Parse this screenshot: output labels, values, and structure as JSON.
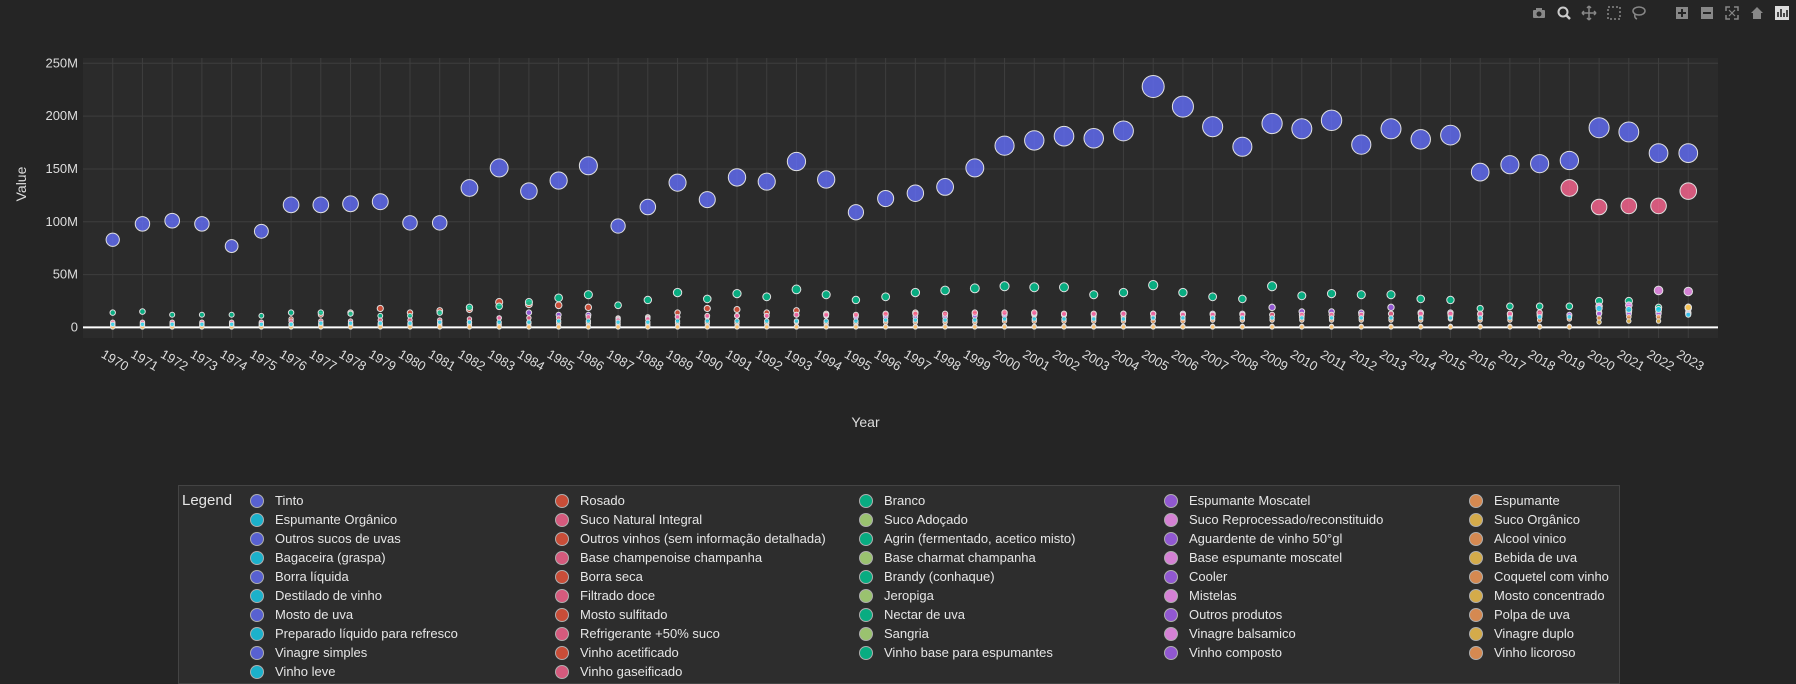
{
  "toolbar": {
    "buttons": [
      {
        "name": "camera-icon"
      },
      {
        "name": "zoom-icon"
      },
      {
        "name": "pan-icon"
      },
      {
        "name": "box-select-icon"
      },
      {
        "name": "lasso-icon"
      },
      {
        "name": "zoom-in-icon"
      },
      {
        "name": "zoom-out-icon"
      },
      {
        "name": "autoscale-icon"
      },
      {
        "name": "home-icon"
      },
      {
        "name": "plotly-logo-icon"
      }
    ]
  },
  "colors": {
    "background": "#252525",
    "plot_bg": "#2b2b2b",
    "grid": "#3e3e3e",
    "zero_line": "#ffffff",
    "text": "#dddddd"
  },
  "chart_data": {
    "type": "scatter",
    "mode": "bubble",
    "xlabel": "Year",
    "ylabel": "Value",
    "ylim": [
      -10000000,
      255000000
    ],
    "yticks": [
      {
        "value": 0,
        "label": "0"
      },
      {
        "value": 50000000,
        "label": "50M"
      },
      {
        "value": 100000000,
        "label": "100M"
      },
      {
        "value": 150000000,
        "label": "150M"
      },
      {
        "value": 200000000,
        "label": "200M"
      },
      {
        "value": 250000000,
        "label": "250M"
      }
    ],
    "x": [
      1970,
      1971,
      1972,
      1973,
      1974,
      1975,
      1976,
      1977,
      1978,
      1979,
      1980,
      1981,
      1982,
      1983,
      1984,
      1985,
      1986,
      1987,
      1988,
      1989,
      1990,
      1991,
      1992,
      1993,
      1994,
      1995,
      1996,
      1997,
      1998,
      1999,
      2000,
      2001,
      2002,
      2003,
      2004,
      2005,
      2006,
      2007,
      2008,
      2009,
      2010,
      2011,
      2012,
      2013,
      2014,
      2015,
      2016,
      2017,
      2018,
      2019,
      2020,
      2021,
      2022,
      2023
    ],
    "legend_title": "Legend",
    "legend_columns": [
      [
        "Tinto",
        "Espumante Orgânico",
        "Outros sucos de uvas",
        "Bagaceira (graspa)",
        "Borra líquida",
        "Destilado de vinho",
        "Mosto de uva",
        "Preparado líquido para refresco",
        "Vinagre simples",
        "Vinho leve"
      ],
      [
        "Rosado",
        "Suco Natural Integral",
        "Outros vinhos (sem informação detalhada)",
        "Base champenoise champanha",
        "Borra seca",
        "Filtrado doce",
        "Mosto sulfitado",
        "Refrigerante +50% suco",
        "Vinho acetificado",
        "Vinho gaseificado"
      ],
      [
        "Branco",
        "Suco Adoçado",
        "Agrin (fermentado, acetico misto)",
        "Base charmat champanha",
        "Brandy (conhaque)",
        "Jeropiga",
        "Nectar de uva",
        "Sangria",
        "Vinho base para espumantes"
      ],
      [
        "Espumante  Moscatel",
        "Suco Reprocessado/reconstituido",
        "Aguardente de vinho 50°gl",
        "Base espumante moscatel",
        "Cooler",
        "Mistelas",
        "Outros produtos",
        "Vinagre balsamico",
        "Vinho composto"
      ],
      [
        "Espumante",
        "Suco Orgânico",
        "Alcool vinico",
        "Bebida de uva",
        "Coquetel com vinho",
        "Mosto concentrado",
        "Polpa de uva",
        "Vinagre duplo",
        "Vinho licoroso"
      ]
    ],
    "palette": [
      "#636efa",
      "#ef553b",
      "#00cc96",
      "#ab63fa",
      "#ffa15a",
      "#19d3f3",
      "#ff6692",
      "#b6e880",
      "#ff97ff",
      "#fecb52"
    ],
    "series": [
      {
        "legend_index": 0,
        "color": "#636efa",
        "values": [
          83000000,
          98000000,
          101000000,
          98000000,
          77000000,
          91000000,
          116000000,
          116000000,
          117000000,
          119000000,
          99000000,
          99000000,
          132000000,
          151000000,
          129000000,
          139000000,
          153000000,
          96000000,
          114000000,
          137000000,
          121000000,
          142000000,
          138000000,
          157000000,
          140000000,
          109000000,
          122000000,
          127000000,
          133000000,
          151000000,
          172000000,
          177000000,
          181000000,
          179000000,
          186000000,
          228000000,
          209000000,
          190000000,
          171000000,
          193000000,
          188000000,
          196000000,
          173000000,
          188000000,
          178000000,
          182000000,
          147000000,
          154000000,
          155000000,
          158000000,
          189000000,
          185000000,
          165000000,
          165000000
        ]
      },
      {
        "legend_index": 1,
        "color": "#ef553b",
        "values": [
          4000000,
          4000000,
          4000000,
          4000000,
          4000000,
          4000000,
          8000000,
          12000000,
          14000000,
          18000000,
          14000000,
          16000000,
          17000000,
          24000000,
          22000000,
          21000000,
          19000000,
          9000000,
          10000000,
          14000000,
          18000000,
          17000000,
          14000000,
          16000000,
          13000000,
          11000000,
          12000000,
          14000000,
          11000000,
          13000000,
          13000000,
          12000000,
          12000000,
          10000000,
          10000000,
          10000000,
          8000000,
          9000000,
          9000000,
          9000000,
          10000000,
          9000000,
          9000000,
          9000000,
          10000000,
          11000000,
          9000000,
          11000000,
          11000000,
          11000000,
          14000000,
          15000000,
          14000000,
          14000000
        ]
      },
      {
        "legend_index": 2,
        "color": "#00cc96",
        "values": [
          14000000,
          15000000,
          12000000,
          12000000,
          12000000,
          11000000,
          14000000,
          14000000,
          13000000,
          11000000,
          11000000,
          14000000,
          19000000,
          20000000,
          24000000,
          28000000,
          31000000,
          21000000,
          26000000,
          33000000,
          27000000,
          32000000,
          29000000,
          36000000,
          31000000,
          26000000,
          29000000,
          33000000,
          35000000,
          37000000,
          39000000,
          38000000,
          38000000,
          31000000,
          33000000,
          40000000,
          33000000,
          29000000,
          27000000,
          39000000,
          30000000,
          32000000,
          31000000,
          31000000,
          27000000,
          26000000,
          18000000,
          20000000,
          20000000,
          20000000,
          25000000,
          25000000,
          19000000,
          18000000
        ]
      },
      {
        "legend_index": 3,
        "color": "#ab63fa",
        "values": [
          2000000,
          2000000,
          2000000,
          2000000,
          2000000,
          2000000,
          3000000,
          3000000,
          3000000,
          3000000,
          3000000,
          4000000,
          5000000,
          9000000,
          14000000,
          12000000,
          12000000,
          8000000,
          9000000,
          10000000,
          10000000,
          11000000,
          11000000,
          12000000,
          11000000,
          10000000,
          10000000,
          10000000,
          10000000,
          11000000,
          12000000,
          13000000,
          12000000,
          12000000,
          13000000,
          13000000,
          13000000,
          13000000,
          13000000,
          19000000,
          15000000,
          15000000,
          14000000,
          19000000,
          14000000,
          14000000,
          12000000,
          12000000,
          12000000,
          12000000,
          13000000,
          13000000,
          13000000,
          13000000
        ]
      },
      {
        "legend_index": 4,
        "color": "#ffa15a",
        "values": [
          1000000,
          1000000,
          1000000,
          1000000,
          1000000,
          1000000,
          2000000,
          2000000,
          2000000,
          2000000,
          2000000,
          2000000,
          3000000,
          3000000,
          4000000,
          4000000,
          4000000,
          3000000,
          3000000,
          4000000,
          4000000,
          4000000,
          4000000,
          5000000,
          4000000,
          4000000,
          5000000,
          5000000,
          5000000,
          5000000,
          6000000,
          6000000,
          6000000,
          6000000,
          6000000,
          6000000,
          6000000,
          7000000,
          7000000,
          7000000,
          7000000,
          7000000,
          7000000,
          7000000,
          7000000,
          8000000,
          7000000,
          7000000,
          7000000,
          8000000,
          9000000,
          10000000,
          10000000,
          19000000
        ]
      },
      {
        "legend_index": 6,
        "color": "#ff6692",
        "values": [
          5000000,
          5000000,
          5000000,
          5000000,
          5000000,
          5000000,
          6000000,
          6000000,
          6000000,
          7000000,
          7000000,
          7000000,
          8000000,
          9000000,
          9000000,
          9000000,
          10000000,
          7000000,
          8000000,
          10000000,
          11000000,
          11000000,
          11000000,
          12000000,
          12000000,
          12000000,
          13000000,
          13000000,
          13000000,
          14000000,
          14000000,
          14000000,
          13000000,
          13000000,
          13000000,
          13000000,
          12000000,
          12000000,
          12000000,
          12000000,
          12000000,
          12000000,
          12000000,
          13000000,
          13000000,
          13000000,
          13000000,
          13000000,
          14000000,
          132000000,
          114000000,
          115000000,
          115000000,
          129000000
        ]
      },
      {
        "legend_index": 8,
        "color": "#ff97ff",
        "values": [
          1000000,
          1000000,
          1000000,
          1000000,
          1000000,
          1000000,
          1000000,
          1000000,
          1000000,
          1000000,
          1000000,
          1000000,
          1000000,
          1000000,
          1000000,
          1000000,
          1000000,
          1000000,
          1000000,
          1000000,
          1000000,
          1000000,
          1000000,
          1000000,
          1000000,
          1000000,
          1000000,
          1000000,
          1000000,
          1000000,
          1000000,
          1000000,
          1000000,
          1000000,
          1000000,
          1000000,
          1000000,
          1000000,
          1000000,
          1000000,
          1000000,
          1000000,
          1000000,
          1000000,
          1000000,
          1000000,
          1000000,
          1000000,
          1000000,
          1000000,
          20000000,
          21000000,
          35000000,
          34000000
        ]
      },
      {
        "legend_index": 9,
        "color": "#fecb52",
        "values": [
          500000,
          500000,
          500000,
          500000,
          500000,
          500000,
          500000,
          500000,
          500000,
          500000,
          500000,
          500000,
          500000,
          500000,
          500000,
          500000,
          500000,
          500000,
          500000,
          500000,
          500000,
          500000,
          500000,
          500000,
          500000,
          500000,
          500000,
          500000,
          500000,
          500000,
          500000,
          500000,
          500000,
          500000,
          500000,
          500000,
          500000,
          500000,
          500000,
          500000,
          500000,
          500000,
          500000,
          500000,
          500000,
          500000,
          500000,
          500000,
          500000,
          500000,
          5000000,
          6000000,
          6000000,
          19000000
        ]
      },
      {
        "legend_index": 5,
        "color": "#19d3f3",
        "values": [
          3000000,
          3000000,
          3000000,
          3000000,
          3000000,
          3000000,
          3000000,
          4000000,
          4000000,
          4000000,
          4000000,
          5000000,
          5000000,
          5000000,
          5000000,
          6000000,
          6000000,
          5000000,
          5000000,
          6000000,
          6000000,
          6000000,
          6000000,
          6000000,
          6000000,
          6000000,
          7000000,
          7000000,
          7000000,
          7000000,
          8000000,
          8000000,
          8000000,
          8000000,
          8000000,
          9000000,
          9000000,
          9000000,
          9000000,
          9000000,
          9000000,
          9000000,
          9000000,
          9000000,
          9000000,
          9000000,
          9000000,
          9000000,
          10000000,
          10000000,
          18000000,
          17000000,
          17000000,
          12000000
        ]
      }
    ]
  }
}
